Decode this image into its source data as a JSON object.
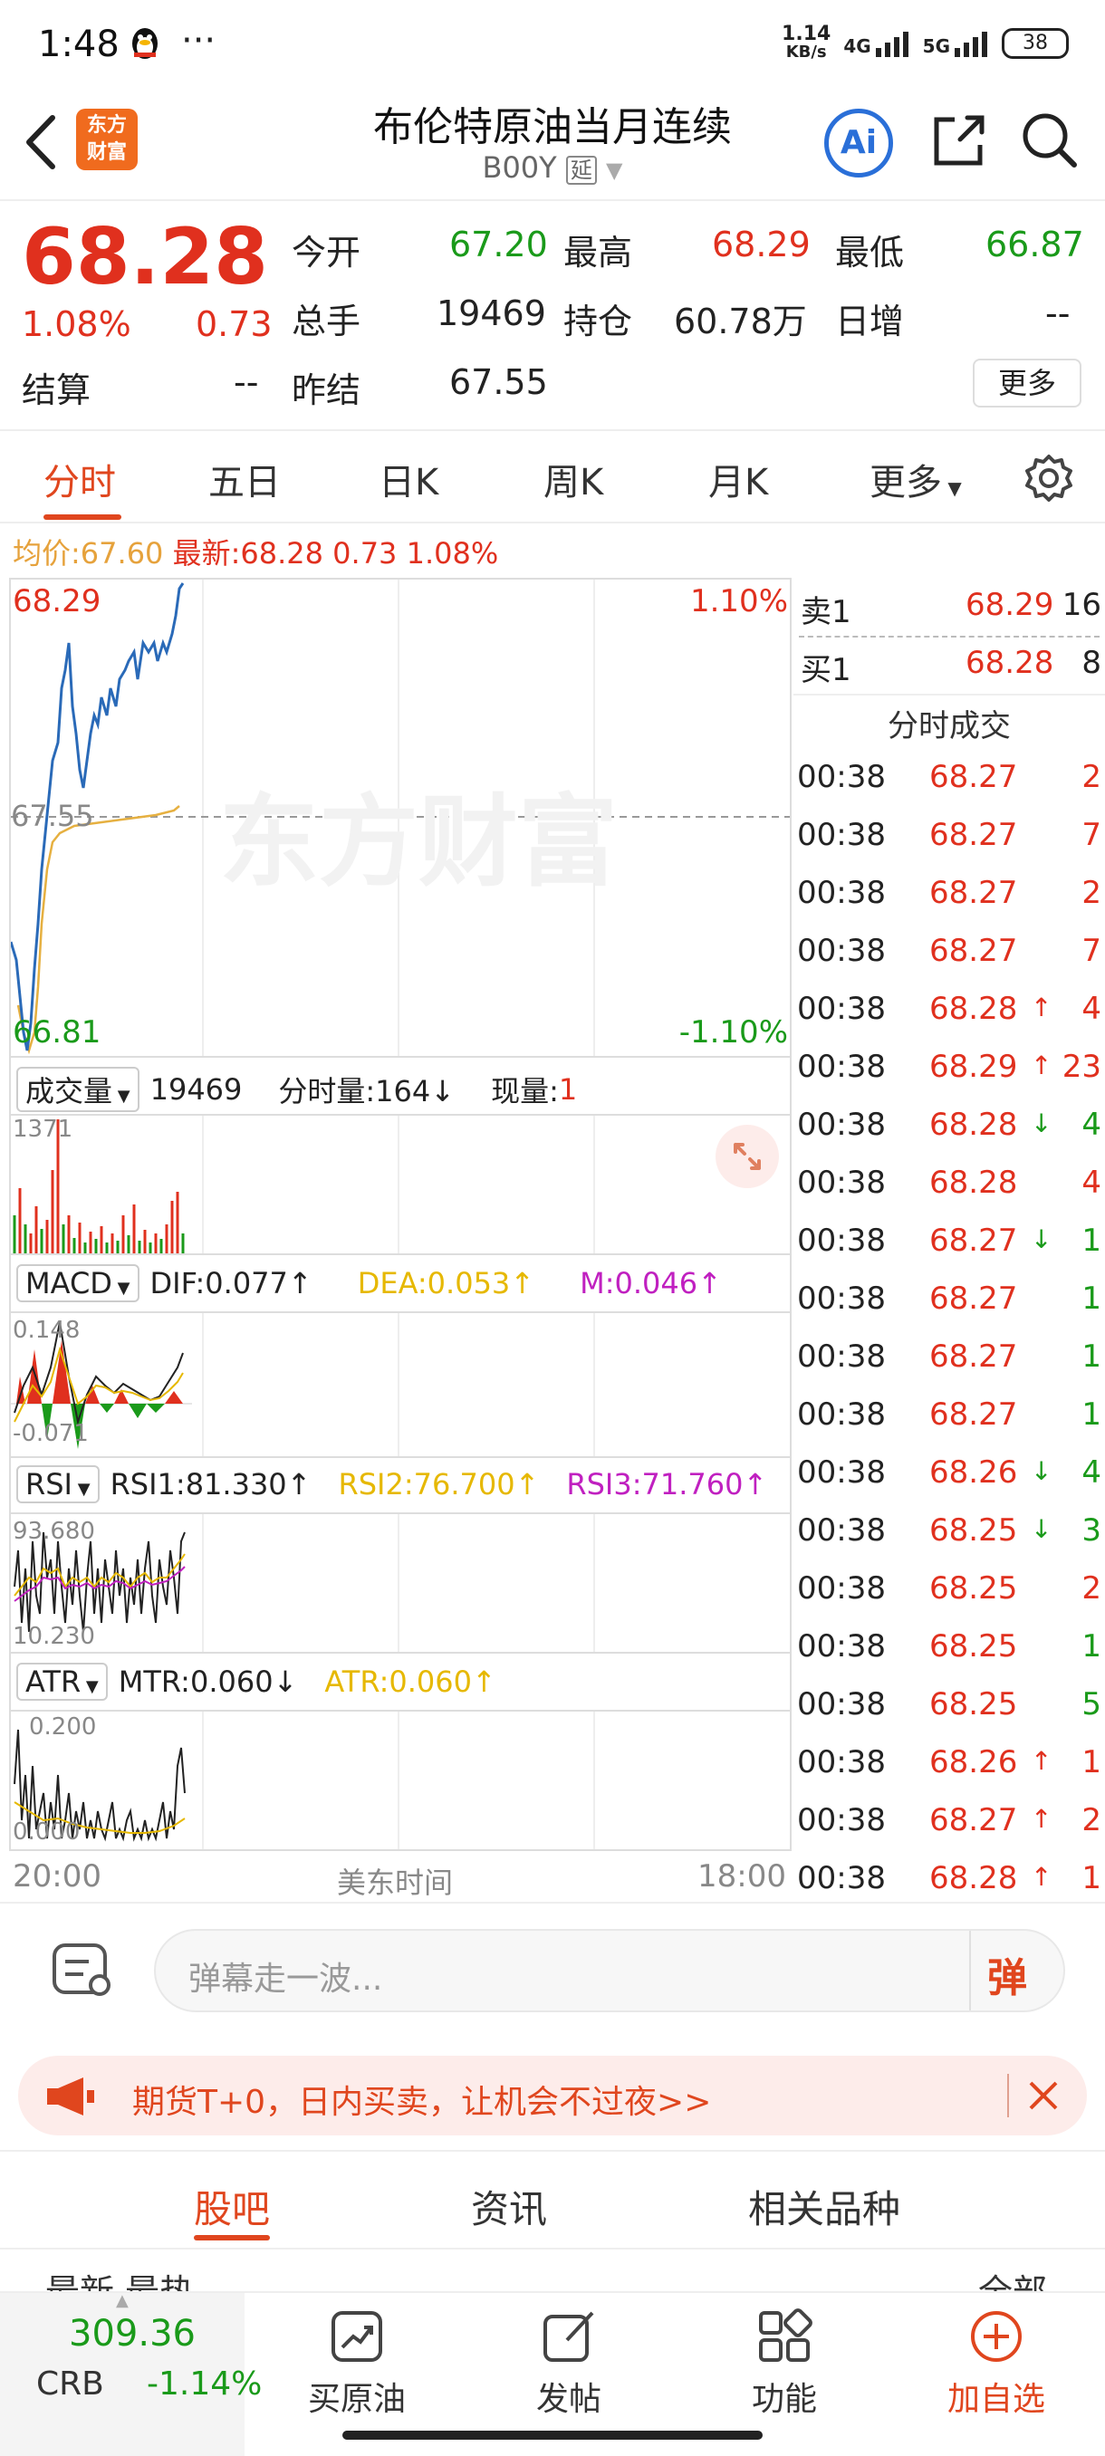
{
  "status_bar": {
    "time": "1:48",
    "extra": "···",
    "net_speed_top": "1.14",
    "net_speed_bottom": "KB/s",
    "net1": "4G",
    "net2": "5G",
    "battery": "38"
  },
  "header": {
    "title": "布伦特原油当月连续",
    "code": "B00Y",
    "delay_badge": "延",
    "logo_line1": "东方",
    "logo_line2": "财富",
    "ai_label": "Ai"
  },
  "quote": {
    "price": "68.28",
    "change_pct": "1.08%",
    "change": "0.73",
    "settle_label": "结算",
    "settle_value": "--",
    "open_label": "今开",
    "open_value": "67.20",
    "high_label": "最高",
    "high_value": "68.29",
    "low_label": "最低",
    "low_value": "66.87",
    "volume_label": "总手",
    "volume_value": "19469",
    "oi_label": "持仓",
    "oi_value": "60.78万",
    "daily_inc_label": "日增",
    "daily_inc_value": "--",
    "prev_settle_label": "昨结",
    "prev_settle_value": "67.55",
    "more_label": "更多"
  },
  "tabs": {
    "items": [
      "分时",
      "五日",
      "日K",
      "周K",
      "月K",
      "更多"
    ],
    "active": "分时"
  },
  "avg_line": {
    "avg_label": "均价:",
    "avg_value": "67.60",
    "latest_label": "最新:",
    "latest_value": "68.28",
    "chg": "0.73",
    "pct": "1.08%"
  },
  "chart": {
    "top_price": "68.29",
    "top_pct": "1.10%",
    "mid_price": "67.55",
    "bottom_price": "66.81",
    "bottom_pct": "-1.10%",
    "watermark": "东方财富",
    "vol": {
      "select": "成交量",
      "total": "19469",
      "minute_label": "分时量:164↓",
      "now_label": "现量:",
      "now_value": "1",
      "max": "1371"
    },
    "macd": {
      "select": "MACD",
      "dif": "DIF:0.077↑",
      "dea": "DEA:0.053↑",
      "m": "M:0.046↑",
      "top": "0.148",
      "bottom": "-0.071"
    },
    "rsi": {
      "select": "RSI",
      "r1": "RSI1:81.330↑",
      "r2": "RSI2:76.700↑",
      "r3": "RSI3:71.760↑",
      "top": "93.680",
      "bottom": "10.230"
    },
    "atr": {
      "select": "ATR",
      "mtr": "MTR:0.060↓",
      "atr": "ATR:0.060↑",
      "top": "0.200",
      "bottom": "0.000"
    },
    "x_start": "20:00",
    "x_mid": "美东时间",
    "x_end": "18:00"
  },
  "orderbook": {
    "sell_label": "卖1",
    "sell_price": "68.29",
    "sell_qty": "16",
    "buy_label": "买1",
    "buy_price": "68.28",
    "buy_qty": "8",
    "trades_title": "分时成交"
  },
  "trades": [
    {
      "t": "00:38",
      "p": "68.27",
      "arrow": "",
      "q": "2",
      "qc": "red"
    },
    {
      "t": "00:38",
      "p": "68.27",
      "arrow": "",
      "q": "7",
      "qc": "red"
    },
    {
      "t": "00:38",
      "p": "68.27",
      "arrow": "",
      "q": "2",
      "qc": "red"
    },
    {
      "t": "00:38",
      "p": "68.27",
      "arrow": "",
      "q": "7",
      "qc": "red"
    },
    {
      "t": "00:38",
      "p": "68.28",
      "arrow": "↑",
      "q": "4",
      "qc": "red"
    },
    {
      "t": "00:38",
      "p": "68.29",
      "arrow": "↑",
      "q": "23",
      "qc": "red"
    },
    {
      "t": "00:38",
      "p": "68.28",
      "arrow": "↓",
      "q": "4",
      "qc": "green"
    },
    {
      "t": "00:38",
      "p": "68.28",
      "arrow": "",
      "q": "4",
      "qc": "red"
    },
    {
      "t": "00:38",
      "p": "68.27",
      "arrow": "↓",
      "q": "1",
      "qc": "green"
    },
    {
      "t": "00:38",
      "p": "68.27",
      "arrow": "",
      "q": "1",
      "qc": "green"
    },
    {
      "t": "00:38",
      "p": "68.27",
      "arrow": "",
      "q": "1",
      "qc": "green"
    },
    {
      "t": "00:38",
      "p": "68.27",
      "arrow": "",
      "q": "1",
      "qc": "green"
    },
    {
      "t": "00:38",
      "p": "68.26",
      "arrow": "↓",
      "q": "4",
      "qc": "green"
    },
    {
      "t": "00:38",
      "p": "68.25",
      "arrow": "↓",
      "q": "3",
      "qc": "green"
    },
    {
      "t": "00:38",
      "p": "68.25",
      "arrow": "",
      "q": "2",
      "qc": "red"
    },
    {
      "t": "00:38",
      "p": "68.25",
      "arrow": "",
      "q": "1",
      "qc": "green"
    },
    {
      "t": "00:38",
      "p": "68.25",
      "arrow": "",
      "q": "5",
      "qc": "green"
    },
    {
      "t": "00:38",
      "p": "68.26",
      "arrow": "↑",
      "q": "1",
      "qc": "red"
    },
    {
      "t": "00:38",
      "p": "68.27",
      "arrow": "↑",
      "q": "2",
      "qc": "red"
    },
    {
      "t": "00:38",
      "p": "68.28",
      "arrow": "↑",
      "q": "1",
      "qc": "red"
    }
  ],
  "comment": {
    "placeholder": "弹幕走一波...",
    "danmu": "弹"
  },
  "banner": {
    "text": "期货T+0，日内买卖，让机会不过夜>>"
  },
  "bottom_tabs": {
    "items": [
      "股吧",
      "资讯",
      "相关品种"
    ],
    "active": "股吧",
    "partial_left": "最新  最热",
    "partial_right": "全部"
  },
  "navbar": {
    "index_value": "309.36",
    "index_name": "CRB",
    "index_pct": "-1.14%",
    "items": [
      "买原油",
      "发帖",
      "功能",
      "加自选"
    ]
  },
  "colors": {
    "up": "#e0301e",
    "down": "#1a9a1a",
    "accent": "#e0461e",
    "price_line": "#2a6ab8",
    "avg_line": "#e6b040"
  }
}
